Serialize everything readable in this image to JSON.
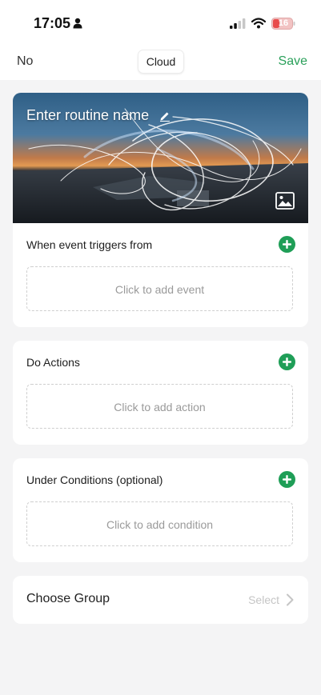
{
  "status_bar": {
    "time": "17:05",
    "battery": "16",
    "icons": [
      "person-icon",
      "signal-icon",
      "wifi-icon",
      "battery-icon"
    ]
  },
  "nav": {
    "cancel_label": "No",
    "mode_label": "Cloud",
    "save_label": "Save"
  },
  "hero": {
    "title_placeholder": "Enter routine name",
    "icons": [
      "pencil-icon",
      "image-icon"
    ]
  },
  "sections": {
    "event": {
      "title": "When event triggers from",
      "placeholder": "Click to add event"
    },
    "action": {
      "title": "Do Actions",
      "placeholder": "Click to add action"
    },
    "condition": {
      "title": "Under Conditions (optional)",
      "placeholder": "Click to add condition"
    }
  },
  "group": {
    "label": "Choose Group",
    "select_label": "Select"
  },
  "colors": {
    "accent_green": "#2aa05a",
    "plus_green": "#1f9e57",
    "battery_red": "#e84a4a"
  }
}
